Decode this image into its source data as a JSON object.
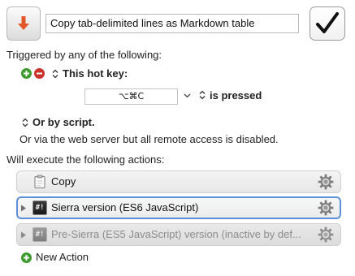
{
  "macro": {
    "icon": "download-arrow-icon",
    "title": "Copy tab-delimited lines as Markdown table",
    "enabled": true,
    "colors": {
      "icon_arrow": "#e2572a",
      "checkmark": "#111111"
    }
  },
  "triggers": {
    "heading": "Triggered by any of the following:",
    "hotkey": {
      "label": "This hot key:",
      "keys": "⌥⌘C",
      "state": "is pressed"
    },
    "script_label": "Or by script.",
    "web_server_note": "Or via the web server but all remote access is disabled."
  },
  "actions": {
    "heading": "Will execute the following actions:",
    "items": [
      {
        "title": "Copy",
        "icon": "clipboard-icon",
        "selected": false,
        "inactive": false,
        "expandable": false
      },
      {
        "title": "Sierra version (ES6 JavaScript)",
        "icon": "script-icon",
        "icon_text": "#!",
        "selected": true,
        "inactive": false,
        "expandable": true
      },
      {
        "title": "Pre-Sierra (ES5 JavaScript) version (inactive by def...",
        "icon": "script-icon",
        "icon_text": "#!",
        "selected": false,
        "inactive": true,
        "expandable": true
      }
    ],
    "new_action_label": "New Action"
  },
  "theme": {
    "selection_border": "#5c8fd8",
    "add_green": "#3d9a2c",
    "remove_red": "#c9322a"
  }
}
